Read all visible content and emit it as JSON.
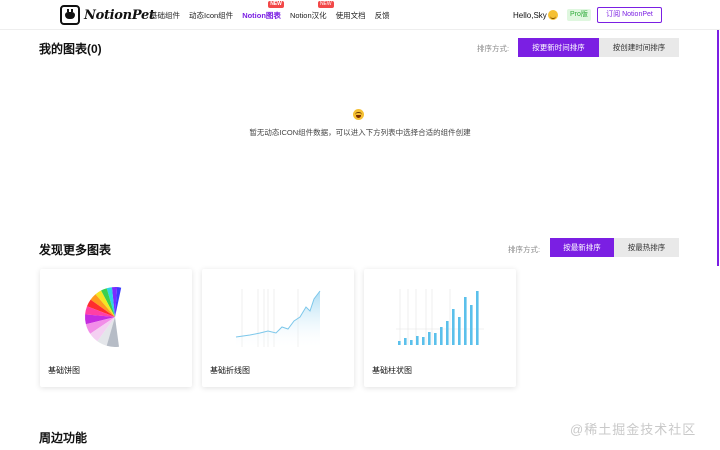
{
  "header": {
    "logo_text": "NotionPet",
    "nav": [
      {
        "label": "基础组件",
        "active": false,
        "new": false
      },
      {
        "label": "动态Icon组件",
        "active": false,
        "new": false
      },
      {
        "label": "Notion图表",
        "active": true,
        "new": true
      },
      {
        "label": "Notion汉化",
        "active": false,
        "new": true
      },
      {
        "label": "使用文档",
        "active": false,
        "new": false
      },
      {
        "label": "反馈",
        "active": false,
        "new": false
      }
    ],
    "new_badge": "NEW",
    "greeting": "Hello,Sky",
    "pro_badge": "Pro版",
    "subscribe_label": "订阅 NotionPet"
  },
  "my_charts": {
    "title": "我的图表(0)",
    "sort_label": "排序方式:",
    "sort_options": [
      "按更新时间排序",
      "按创建时间排序"
    ],
    "empty_text": "暂无动态ICON组件数据，可以进入下方列表中选择合适的组件创建"
  },
  "discover": {
    "title": "发现更多图表",
    "sort_label": "排序方式:",
    "sort_options": [
      "按最新排序",
      "按最热排序"
    ],
    "cards": [
      {
        "label": "基础饼图",
        "icon": "pie-chart-thumbnail"
      },
      {
        "label": "基础折线图",
        "icon": "line-chart-thumbnail"
      },
      {
        "label": "基础柱状图",
        "icon": "bar-chart-thumbnail"
      }
    ]
  },
  "peripheral": {
    "title": "周边功能"
  },
  "watermark": "@稀土掘金技术社区",
  "colors": {
    "accent": "#7b1fe3",
    "new_badge": "#f24848",
    "pro_bg": "#dff7df",
    "pro_text": "#2eaa3a",
    "chart_blue": "#5bc0eb"
  }
}
